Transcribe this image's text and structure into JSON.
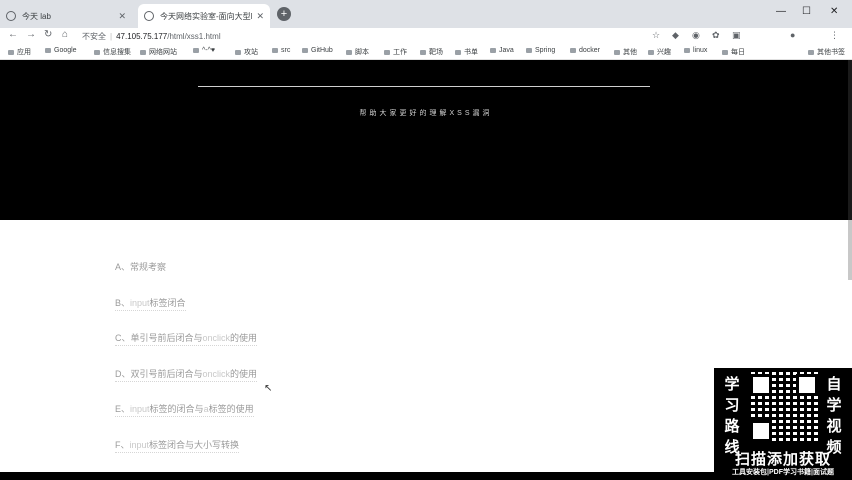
{
  "browser": {
    "tabs": [
      {
        "title": "今天 lab",
        "active": false
      },
      {
        "title": "今天网络实验室-面向大型MOO(",
        "active": true
      }
    ],
    "new_tab": "+",
    "window_controls": {
      "minimize": "—",
      "maximize": "☐",
      "close": "✕"
    },
    "nav": {
      "back": "←",
      "forward": "→",
      "reload": "↻",
      "home": "⌂"
    },
    "url": {
      "security": "不安全",
      "host": "47.105.75.177",
      "path": "/html/xss1.html"
    },
    "bookmarks": [
      "应用",
      "Google",
      "信息搜集",
      "网络网站",
      "^-^♥",
      "攻站",
      "src",
      "GitHub",
      "脚本",
      "工作",
      "靶场",
      "书单",
      "Java",
      "Spring",
      "docker",
      "其他",
      "兴趣",
      "linux",
      "每日",
      "其他书签"
    ]
  },
  "hero": {
    "subtitle": "帮助大家更好的理解XSS漏洞"
  },
  "items": [
    {
      "num": "A、",
      "parts": [
        {
          "t": "常规考察",
          "h": false
        }
      ]
    },
    {
      "num": "B、",
      "parts": [
        {
          "t": "input",
          "h": true
        },
        {
          "t": "标签闭合",
          "h": false
        }
      ]
    },
    {
      "num": "C、",
      "parts": [
        {
          "t": "单引号前后闭合与",
          "h": false
        },
        {
          "t": "onclick",
          "h": true
        },
        {
          "t": "的使用",
          "h": false
        }
      ]
    },
    {
      "num": "D、",
      "parts": [
        {
          "t": "双引号前后闭合与",
          "h": false
        },
        {
          "t": "onclick",
          "h": true
        },
        {
          "t": "的使用",
          "h": false
        }
      ]
    },
    {
      "num": "E、",
      "parts": [
        {
          "t": "input",
          "h": true
        },
        {
          "t": "标签的闭合与",
          "h": false
        },
        {
          "t": "a",
          "h": true
        },
        {
          "t": "标签的使用",
          "h": false
        }
      ]
    },
    {
      "num": "F、",
      "parts": [
        {
          "t": "input",
          "h": true
        },
        {
          "t": "标签闭合与大小写转换",
          "h": false
        }
      ]
    }
  ],
  "ad": {
    "left_text": "学习路线",
    "right_text": "自学视频",
    "cta": "扫描添加获取",
    "footer": "工具安装包|PDF学习书籍|面试题"
  }
}
